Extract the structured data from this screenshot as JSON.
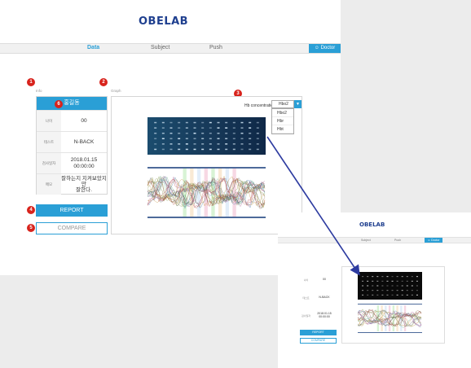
{
  "app": {
    "logo": "OBELAB"
  },
  "nav": {
    "items": [
      {
        "label": "Data",
        "active": true
      },
      {
        "label": "Subject",
        "active": false
      },
      {
        "label": "Push",
        "active": false
      }
    ],
    "doctor_label": "Doctor"
  },
  "markers": [
    "1",
    "2",
    "3",
    "4",
    "5",
    "6"
  ],
  "labels": {
    "info": "Info",
    "graph": "Graph"
  },
  "info": {
    "name": "홍길동",
    "rows": [
      {
        "key": "나이",
        "value": "00"
      },
      {
        "key": "테스트",
        "value": "N-BACK"
      },
      {
        "key": "검사일자",
        "value": "2018.01.15\n00:00:00"
      },
      {
        "key": "메모",
        "value": "잘하는지 지켜보았지만\n잘한다."
      }
    ]
  },
  "buttons": {
    "report": "REPORT",
    "compare": "COMPARE"
  },
  "hb": {
    "label": "Hb concentration",
    "selected": "Hbo2",
    "options": [
      "Hbo2",
      "Hbr",
      "Hbt"
    ]
  },
  "inset": {
    "logo": "OBELAB",
    "nav": [
      "Subject",
      "Push"
    ],
    "doctor_label": "Doctor",
    "rows": [
      {
        "key": "나이",
        "value": "00"
      },
      {
        "key": "테스트",
        "value": "N-BACK"
      },
      {
        "key": "검사일자",
        "value": "2018.01.15\n00:00:00"
      }
    ],
    "report": "REPORT",
    "compare": "COMPARE"
  },
  "colors": {
    "accent": "#2a9fd6",
    "logo": "#1f3f8f",
    "marker": "#d8231c",
    "arrow": "#2d3ba0"
  }
}
